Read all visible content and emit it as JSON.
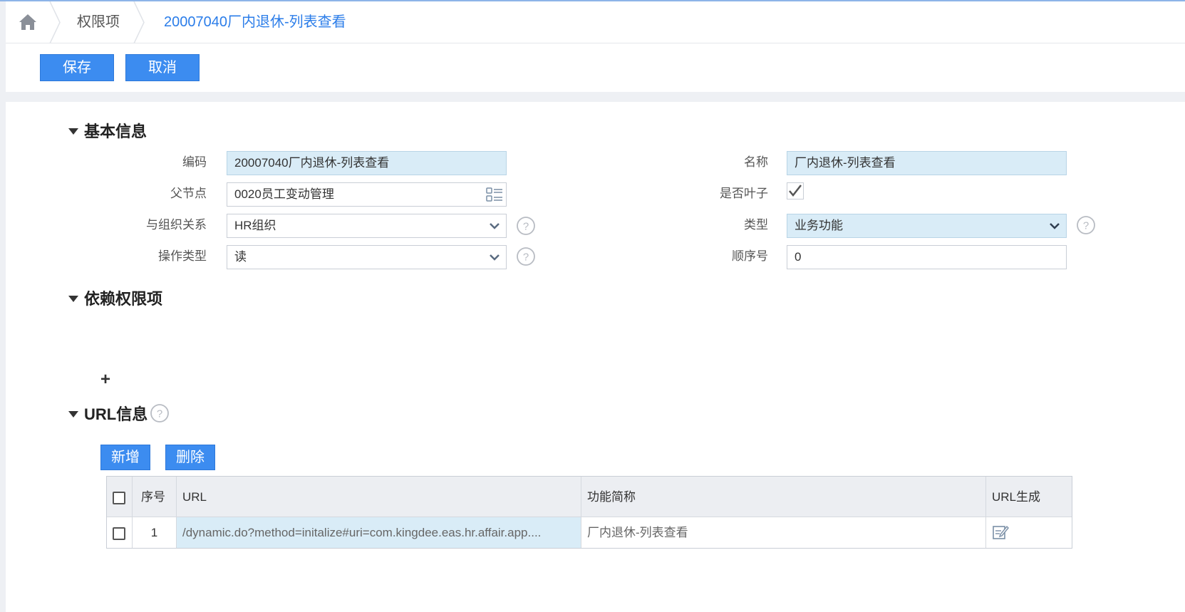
{
  "breadcrumb": {
    "home_icon": "home-icon",
    "items": [
      "权限项",
      "20007040厂内退休-列表查看"
    ]
  },
  "toolbar": {
    "save_label": "保存",
    "cancel_label": "取消"
  },
  "basic_info": {
    "title": "基本信息",
    "code_label": "编码",
    "code_value": "20007040厂内退休-列表查看",
    "name_label": "名称",
    "name_value": "厂内退休-列表查看",
    "parent_label": "父节点",
    "parent_value": "0020员工变动管理",
    "is_leaf_label": "是否叶子",
    "is_leaf_checked": true,
    "org_relation_label": "与组织关系",
    "org_relation_value": "HR组织",
    "type_label": "类型",
    "type_value": "业务功能",
    "op_type_label": "操作类型",
    "op_type_value": "读",
    "order_label": "顺序号",
    "order_value": "0"
  },
  "depend": {
    "title": "依赖权限项",
    "add_symbol": "+"
  },
  "url_info": {
    "title": "URL信息",
    "add_label": "新增",
    "delete_label": "删除",
    "columns": [
      "序号",
      "URL",
      "功能简称",
      "URL生成"
    ],
    "rows": [
      {
        "seq": "1",
        "url": "/dynamic.do?method=initalize#uri=com.kingdee.eas.hr.affair.app....",
        "short_name": "厂内退休-列表查看",
        "gen_icon": "edit-icon"
      }
    ]
  },
  "colors": {
    "accent": "#3c8cf0",
    "link": "#2b7de9",
    "readonly_bg": "#d9ecf7"
  }
}
